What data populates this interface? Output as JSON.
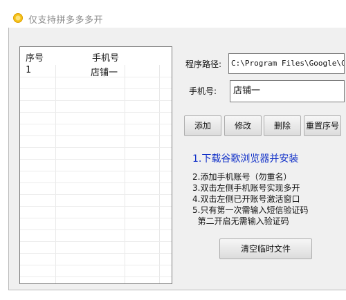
{
  "window": {
    "title": "仅支持拼多多多开"
  },
  "list": {
    "columns": [
      "序号",
      "手机号"
    ],
    "rows": [
      {
        "index": "1",
        "phone": "店铺一"
      }
    ]
  },
  "form": {
    "path_label": "程序路径:",
    "path_value": "C:\\Program Files\\Google\\Chrome\\Application\\chrome.exe",
    "phone_label": "手机号:",
    "phone_value": "店铺一"
  },
  "buttons": {
    "add": "添加",
    "edit": "修改",
    "delete": "删除",
    "reset_index": "重置序号",
    "clear_temp": "清空临时文件"
  },
  "instructions": {
    "heading": "1.下载谷歌浏览器并安装",
    "lines": [
      "2.添加手机账号（勿重名）",
      "3.双击左侧手机账号实现多开",
      "4.双击左侧已开账号激活窗口",
      "5.只有第一次需输入短信验证码",
      "  第二开启无需输入验证码"
    ]
  },
  "colors": {
    "heading": "#1030c8",
    "background": "#f0f0f0"
  }
}
